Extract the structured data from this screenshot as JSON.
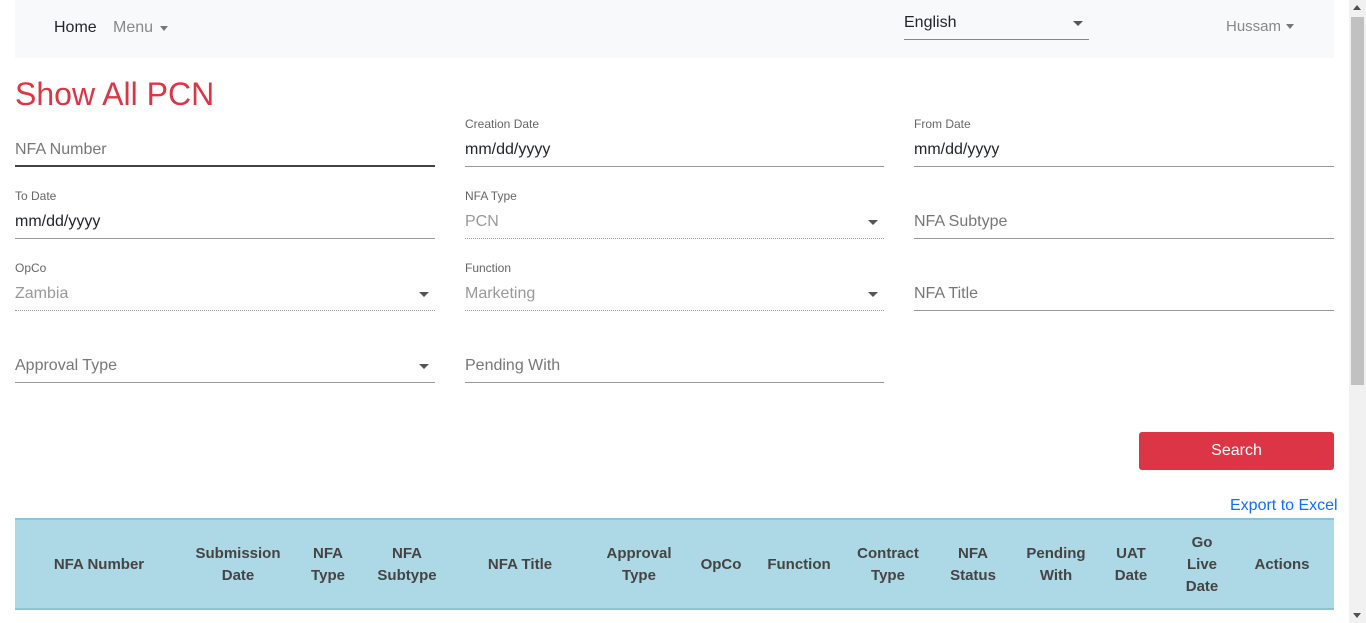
{
  "nav": {
    "home": "Home",
    "menu": "Menu",
    "language": "English",
    "user": "Hussam"
  },
  "page": {
    "title": "Show All PCN"
  },
  "filters": {
    "nfa_number": {
      "placeholder": "NFA Number"
    },
    "creation_date": {
      "label": "Creation Date",
      "value": "mm/dd/yyyy"
    },
    "from_date": {
      "label": "From Date",
      "value": "mm/dd/yyyy"
    },
    "to_date": {
      "label": "To Date",
      "value": "mm/dd/yyyy"
    },
    "nfa_type": {
      "label": "NFA Type",
      "value": "PCN"
    },
    "nfa_subtype": {
      "placeholder": "NFA Subtype"
    },
    "opco": {
      "label": "OpCo",
      "value": "Zambia"
    },
    "function": {
      "label": "Function",
      "value": "Marketing"
    },
    "nfa_title": {
      "placeholder": "NFA Title"
    },
    "approval_type": {
      "placeholder": "Approval Type"
    },
    "pending_with": {
      "placeholder": "Pending With"
    }
  },
  "actions": {
    "search": "Search",
    "export": "Export to Excel"
  },
  "table": {
    "columns": [
      [
        "NFA Number"
      ],
      [
        "Submission",
        "Date"
      ],
      [
        "NFA",
        "Type"
      ],
      [
        "NFA",
        "Subtype"
      ],
      [
        "NFA Title"
      ],
      [
        "Approval",
        "Type"
      ],
      [
        "OpCo"
      ],
      [
        "Function"
      ],
      [
        "Contract",
        "Type"
      ],
      [
        "NFA",
        "Status"
      ],
      [
        "Pending",
        "With"
      ],
      [
        "UAT",
        "Date"
      ],
      [
        "Go",
        "Live",
        "Date"
      ],
      [
        "Actions"
      ]
    ]
  },
  "colors": {
    "accent": "#dc3545",
    "header_bg": "#add8e6",
    "link": "#0d6efd"
  },
  "icons": {
    "dropdown": "chevron-down-icon",
    "scroll_up": "arrow-up-icon",
    "scroll_down": "arrow-down-icon"
  }
}
